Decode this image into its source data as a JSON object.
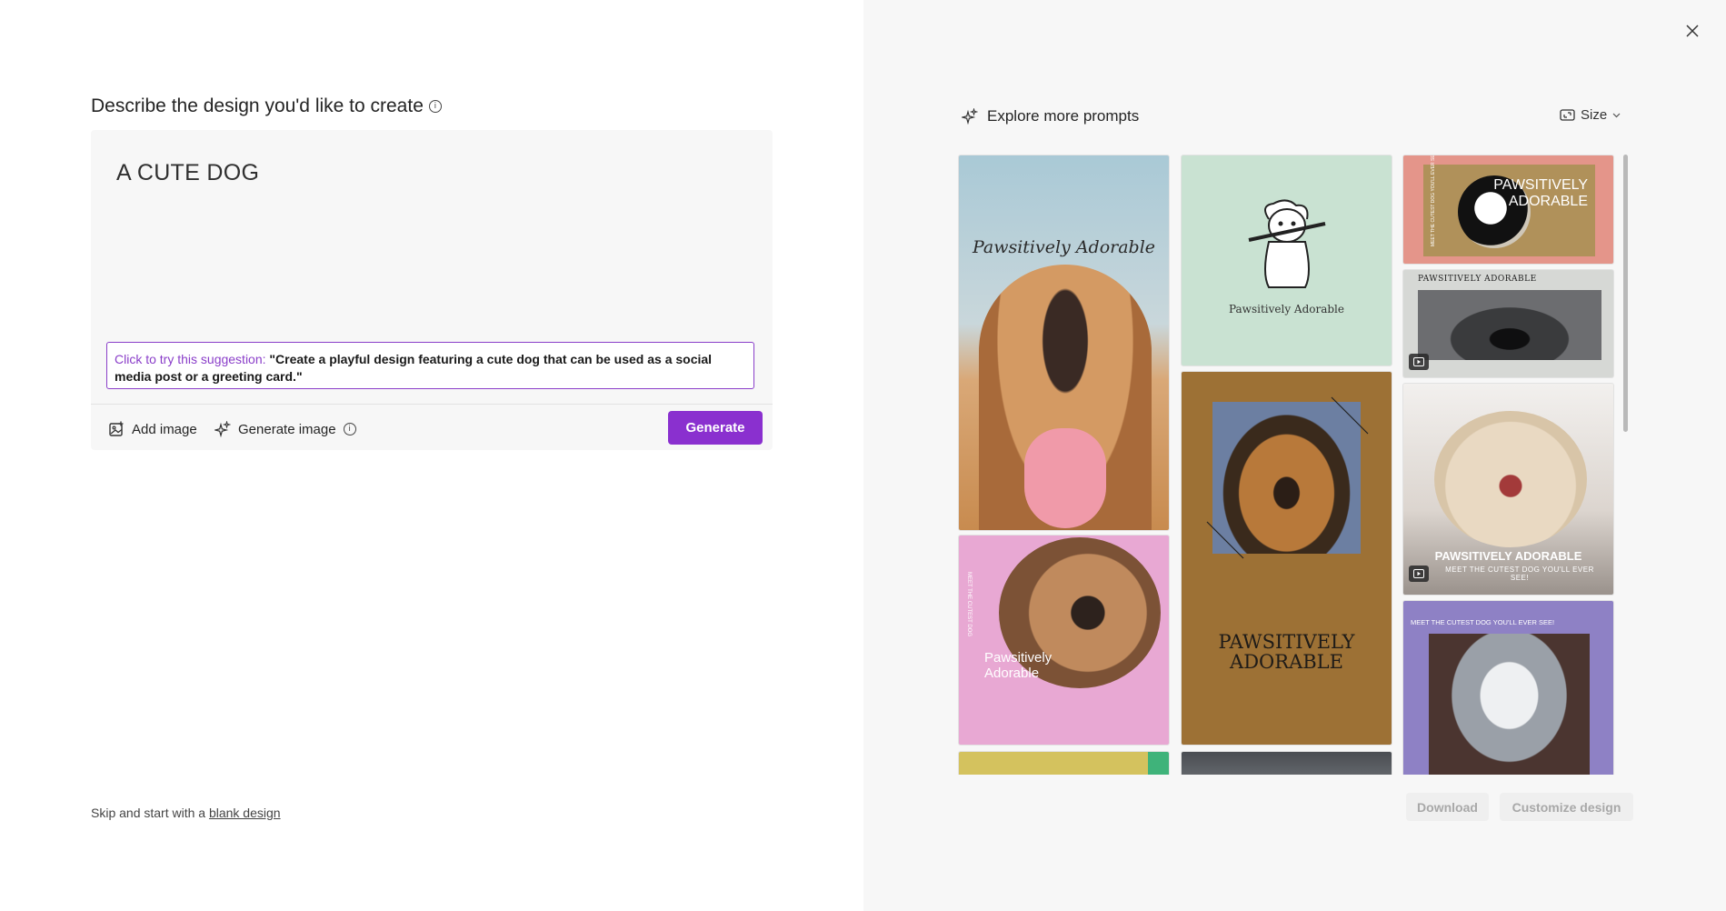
{
  "left": {
    "heading": "Describe the design you'd like to create",
    "prompt_value": "A CUTE DOG",
    "suggestion": {
      "label": "Click to try this suggestion:",
      "text": "\"Create a playful design featuring a cute dog that can be used as a social media post or a greeting card.\""
    },
    "tools": {
      "add_image": "Add image",
      "generate_image": "Generate image"
    },
    "generate": "Generate",
    "skip_prefix": "Skip and start with a",
    "skip_link": "blank design"
  },
  "right": {
    "explore": "Explore more prompts",
    "size": "Size",
    "download": "Download",
    "customize": "Customize design"
  },
  "gallery": {
    "c1_title": "Pawsitively Adorable",
    "c2_title": "Pawsitively Adorable",
    "c3_title_1": "PAWSITIVELY",
    "c3_title_2": "ADORABLE",
    "c3_side": "MEET THE CUTEST DOG YOU'LL EVER SEE",
    "c4_title": "PAWSITIVELY ADORABLE",
    "c5_title_1": "Pawsitively",
    "c5_title_2": "Adorable",
    "c5_side": "MEET THE CUTEST DOG",
    "c6_title_1": "PAWSITIVELY",
    "c6_title_2": "ADORABLE",
    "c7_title": "PAWSITIVELY ADORABLE",
    "c7_sub": "MEET THE CUTEST DOG YOU'LL EVER SEE!",
    "c8_title": "MEET THE CUTEST DOG YOU'LL EVER SEE!"
  }
}
